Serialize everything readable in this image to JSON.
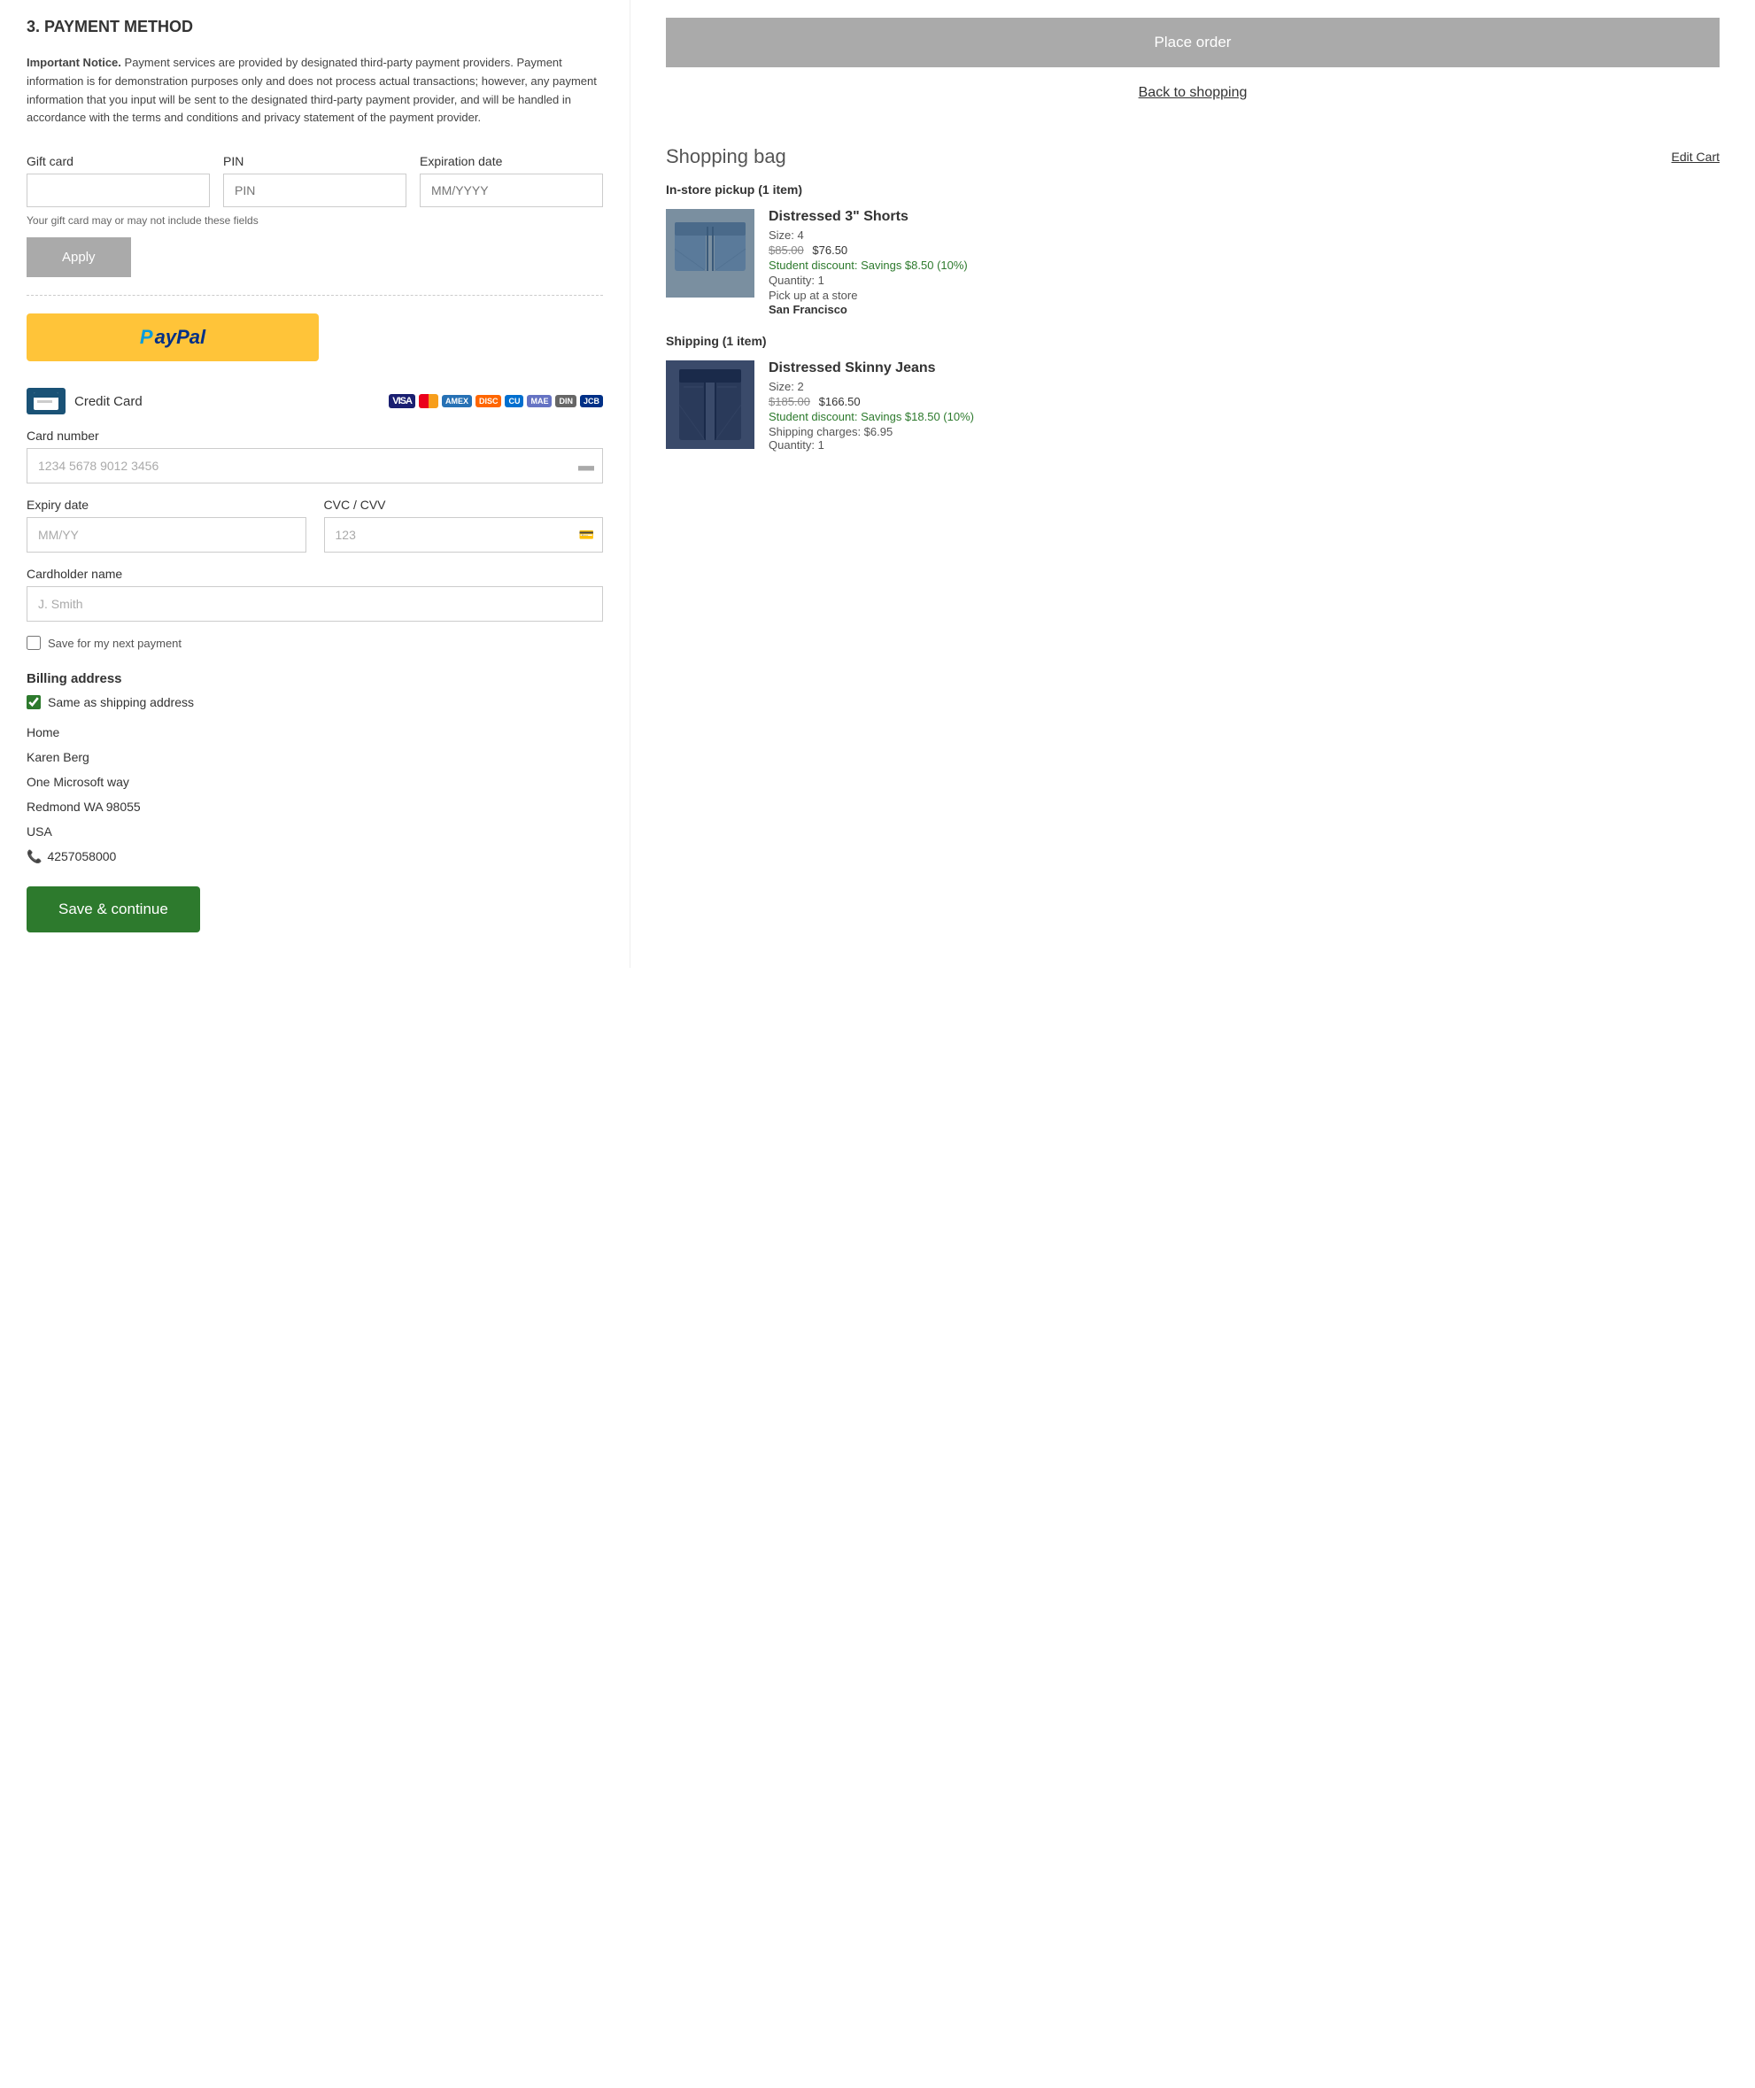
{
  "page": {
    "section_title": "3. PAYMENT METHOD",
    "notice_label": "Important Notice.",
    "notice_text": " Payment services are provided by designated third-party payment providers. Payment information is for demonstration purposes only and does not process actual transactions; however, any payment information that you input will be sent to the designated third-party payment provider, and will be handled in accordance with the terms and conditions and privacy statement of the payment provider.",
    "gift_card_label": "Gift card",
    "pin_label": "PIN",
    "pin_placeholder": "PIN",
    "expiration_label": "Expiration date",
    "expiration_placeholder": "MM/YYYY",
    "gift_card_note": "Your gift card may or may not include these fields",
    "apply_button": "Apply",
    "credit_card_label": "Credit Card",
    "card_number_label": "Card number",
    "card_number_placeholder": "1234 5678 9012 3456",
    "expiry_label": "Expiry date",
    "expiry_placeholder": "MM/YY",
    "cvc_label": "CVC / CVV",
    "cvc_placeholder": "123",
    "cardholder_label": "Cardholder name",
    "cardholder_placeholder": "J. Smith",
    "save_payment_label": "Save for my next payment",
    "billing_title": "Billing address",
    "same_address_label": "Same as shipping address",
    "address_type": "Home",
    "address_name": "Karen Berg",
    "address_line1": "One Microsoft way",
    "address_line2": "Redmond WA  98055",
    "address_country": "USA",
    "address_phone": "4257058000",
    "save_continue_button": "Save & continue",
    "place_order_button": "Place order",
    "back_to_shopping": "Back to shopping",
    "shopping_bag_title": "Shopping bag",
    "edit_cart": "Edit Cart",
    "instore_subtitle": "In-store pickup (1 item)",
    "shipping_subtitle": "Shipping (1 item)",
    "item1": {
      "name": "Distressed 3\" Shorts",
      "size": "Size: 4",
      "original_price": "$85.00",
      "sale_price": "$76.50",
      "discount": "Student discount: Savings $8.50 (10%)",
      "qty": "Quantity: 1",
      "pickup_label": "Pick up at a store",
      "pickup_location": "San Francisco"
    },
    "item2": {
      "name": "Distressed Skinny Jeans",
      "size": "Size: 2",
      "original_price": "$185.00",
      "sale_price": "$166.50",
      "discount": "Student discount: Savings $18.50 (10%)",
      "shipping_charges": "Shipping charges: $6.95",
      "qty": "Quantity: 1"
    },
    "card_logos": [
      "VISA",
      "MC",
      "AMEX",
      "DISC",
      "CU",
      "MAE",
      "DIN",
      "JCB"
    ]
  }
}
